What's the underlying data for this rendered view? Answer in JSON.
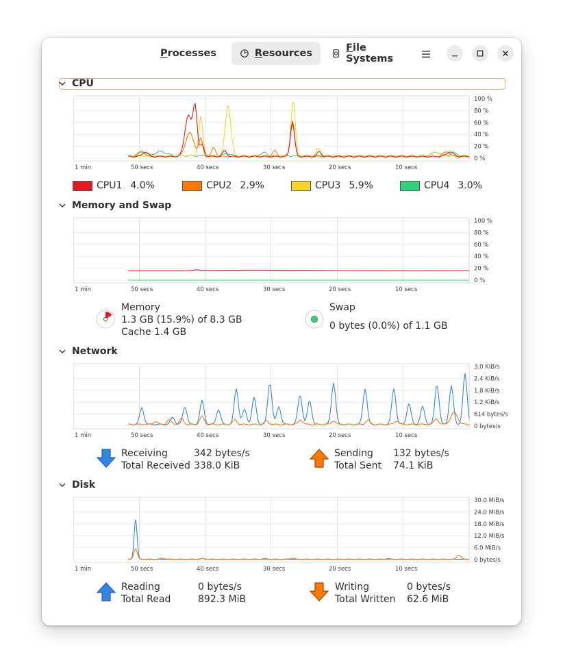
{
  "tabs": [
    {
      "label": "Processes",
      "mnemonic": "P",
      "rest": "rocesses",
      "icon": "list-icon"
    },
    {
      "label": "Resources",
      "mnemonic": "R",
      "rest": "esources",
      "icon": "gauge-icon"
    },
    {
      "label": "File Systems",
      "mnemonic": "F",
      "rest": "ile Systems",
      "icon": "disk-icon"
    }
  ],
  "active_tab": "Resources",
  "window_controls": [
    "minimize-icon",
    "maximize-icon",
    "close-icon"
  ],
  "time_labels": [
    "1 min",
    "50 secs",
    "40 secs",
    "30 secs",
    "20 secs",
    "10 secs"
  ],
  "cpu": {
    "title": "CPU",
    "y_labels": [
      "100 %",
      "80 %",
      "60 %",
      "40 %",
      "20 %",
      "0 %"
    ],
    "cores": [
      {
        "name": "CPU1",
        "value": "4.0%",
        "color": "#e01b24"
      },
      {
        "name": "CPU2",
        "value": "2.9%",
        "color": "#ff7800"
      },
      {
        "name": "CPU3",
        "value": "5.9%",
        "color": "#f6d32d"
      },
      {
        "name": "CPU4",
        "value": "3.0%",
        "color": "#33d17a"
      }
    ]
  },
  "memory": {
    "title": "Memory and Swap",
    "y_labels": [
      "100 %",
      "80 %",
      "60 %",
      "40 %",
      "20 %",
      "0 %"
    ],
    "memory_label": "Memory",
    "memory_value": "1.3 GB (15.9%) of 8.3 GB",
    "cache": "Cache 1.4 GB",
    "memory_fraction": 0.159,
    "memory_color": "#e01b24",
    "swap_label": "Swap",
    "swap_value": "0 bytes (0.0%) of 1.1 GB",
    "swap_color": "#33d17a"
  },
  "network": {
    "title": "Network",
    "y_labels": [
      "3.0 KiB/s",
      "2.4 KiB/s",
      "1.8 KiB/s",
      "1.2 KiB/s",
      "614 bytes/s",
      "0 bytes/s"
    ],
    "receiving_label": "Receiving",
    "receiving_value": "342 bytes/s",
    "total_received_label": "Total Received",
    "total_received_value": "338.0 KiB",
    "sending_label": "Sending",
    "sending_value": "132 bytes/s",
    "total_sent_label": "Total Sent",
    "total_sent_value": "74.1 KiB",
    "receive_color": "#3584e4",
    "send_color": "#ff7800"
  },
  "disk": {
    "title": "Disk",
    "y_labels": [
      "30.0 MiB/s",
      "24.0 MiB/s",
      "18.0 MiB/s",
      "12.0 MiB/s",
      "6.0 MiB/s",
      "0 bytes/s"
    ],
    "reading_label": "Reading",
    "reading_value": "0 bytes/s",
    "total_read_label": "Total Read",
    "total_read_value": "892.3 MiB",
    "writing_label": "Writing",
    "writing_value": "0 bytes/s",
    "total_written_label": "Total Written",
    "total_written_value": "62.6 MiB",
    "read_color": "#3584e4",
    "write_color": "#ff7800"
  }
}
